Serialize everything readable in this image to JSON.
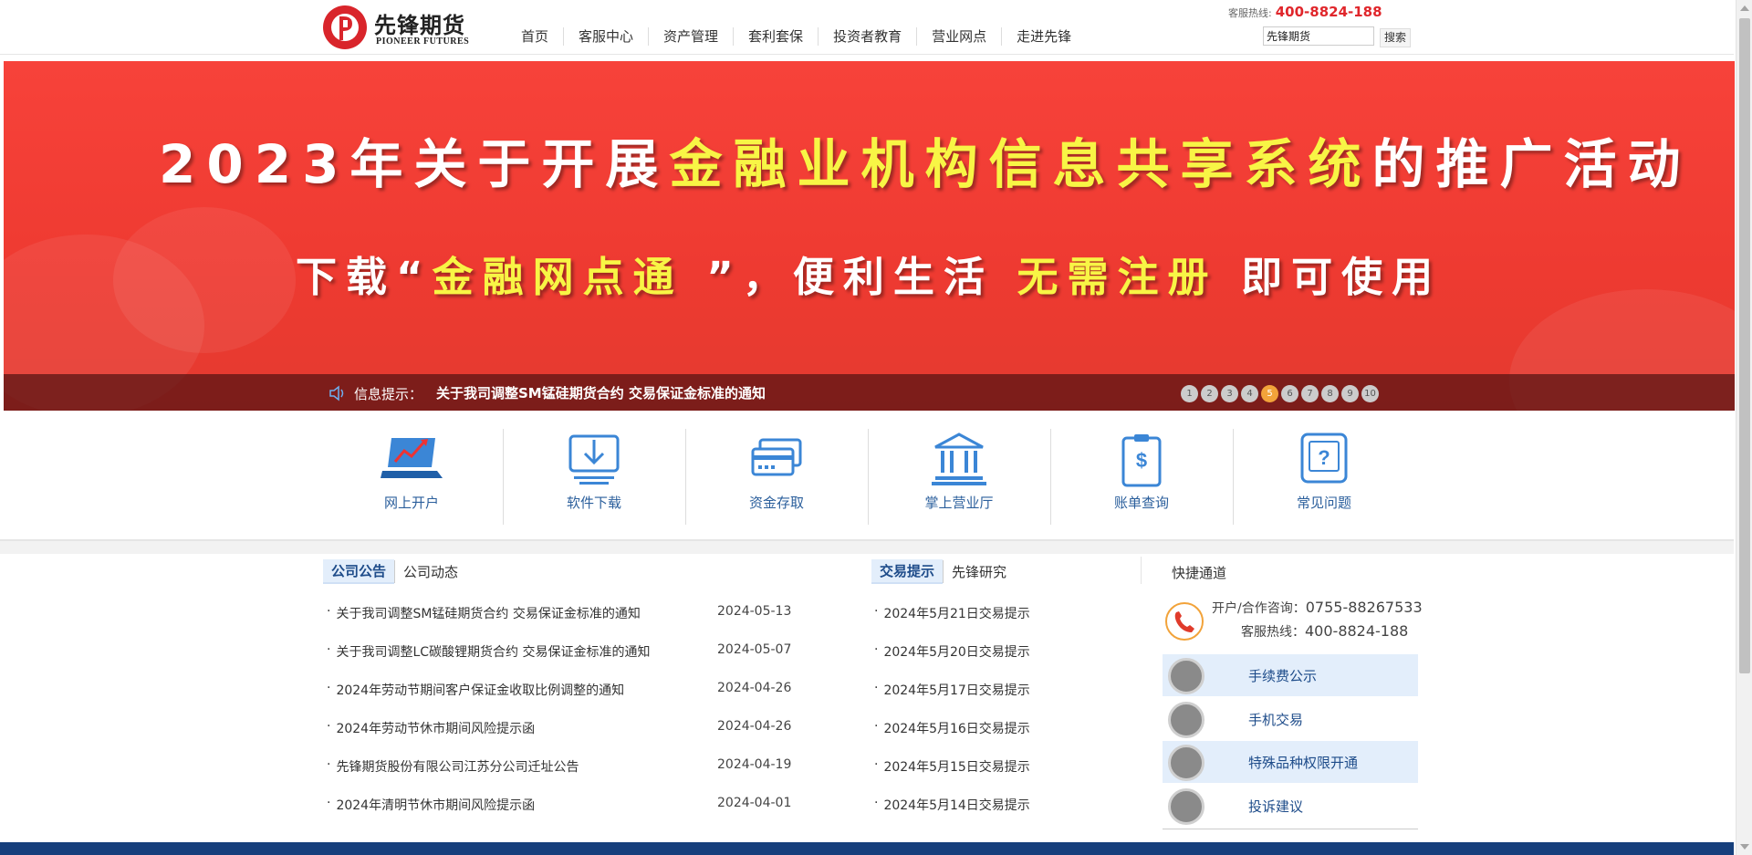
{
  "header": {
    "logo_cn": "先锋期货",
    "logo_en": "PIONEER FUTURES",
    "hotline_label": "客服热线:",
    "hotline_number": "400-8824-188",
    "nav": [
      "首页",
      "客服中心",
      "资产管理",
      "套利套保",
      "投资者教育",
      "营业网点",
      "走进先锋"
    ],
    "search_value": "先锋期货",
    "search_button": "搜索"
  },
  "banner": {
    "line1_a": "2023年关于开展",
    "line1_b": "金融业机构信息共享系统",
    "line1_c": "的推广活动",
    "line2_a": "下载“",
    "line2_b": "金融网点通 ",
    "line2_c": "”，便利生活 ",
    "line2_d": "无需注册",
    "line2_e": " 即可使用",
    "notice_label": "信息提示：",
    "notice_text": "关于我司调整SM锰硅期货合约 交易保证金标准的通知",
    "pages": [
      "1",
      "2",
      "3",
      "4",
      "5",
      "6",
      "7",
      "8",
      "9",
      "10"
    ],
    "active_page": "5"
  },
  "quick_links": [
    "网上开户",
    "软件下载",
    "资金存取",
    "掌上营业厅",
    "账单查询",
    "常见问题"
  ],
  "announcements": {
    "tabs": [
      "公司公告",
      "公司动态"
    ],
    "items": [
      {
        "title": "关于我司调整SM锰硅期货合约 交易保证金标准的通知",
        "date": "2024-05-13"
      },
      {
        "title": "关于我司调整LC碳酸锂期货合约 交易保证金标准的通知",
        "date": "2024-05-07"
      },
      {
        "title": "2024年劳动节期间客户保证金收取比例调整的通知",
        "date": "2024-04-26"
      },
      {
        "title": "2024年劳动节休市期间风险提示函",
        "date": "2024-04-26"
      },
      {
        "title": "先锋期货股份有限公司江苏分公司迁址公告",
        "date": "2024-04-19"
      },
      {
        "title": "2024年清明节休市期间风险提示函",
        "date": "2024-04-01"
      }
    ]
  },
  "trading": {
    "tabs": [
      "交易提示",
      "先锋研究"
    ],
    "items": [
      "2024年5月21日交易提示",
      "2024年5月20日交易提示",
      "2024年5月17日交易提示",
      "2024年5月16日交易提示",
      "2024年5月15日交易提示",
      "2024年5月14日交易提示"
    ]
  },
  "shortcuts": {
    "title": "快捷通道",
    "contact_label1": "开户/合作咨询：",
    "contact_num1": "0755-88267533",
    "contact_label2": "客服热线：",
    "contact_num2": "400-8824-188",
    "items": [
      "手续费公示",
      "手机交易",
      "特殊品种权限开通",
      "投诉建议"
    ]
  },
  "colors": {
    "brand_red": "#e0262b",
    "banner_red": "#ee3a31",
    "link_blue": "#1e4c8a",
    "footer_blue": "#163f7c",
    "active_dot": "#f2a33a"
  }
}
